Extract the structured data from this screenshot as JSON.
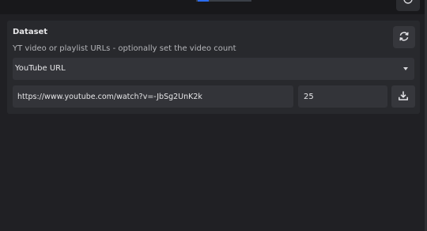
{
  "dataset": {
    "title": "Dataset",
    "subtitle": "YT video or playlist URLs - optionally set the video count",
    "source_select": {
      "selected": "YouTube URL"
    },
    "url_input": {
      "value": "https://www.youtube.com/watch?v=-JbSg2UnK2k"
    },
    "count_input": {
      "value": "25"
    }
  },
  "icons": {
    "top_action": "power-icon",
    "refresh": "refresh-icon",
    "dropdown": "caret-down-icon",
    "download": "download-icon"
  },
  "colors": {
    "background": "#202024",
    "card": "#28292d",
    "field": "#333439",
    "text": "#e6e6e8",
    "muted_text": "#b4b5b9",
    "accent": "#2b6cf0"
  }
}
